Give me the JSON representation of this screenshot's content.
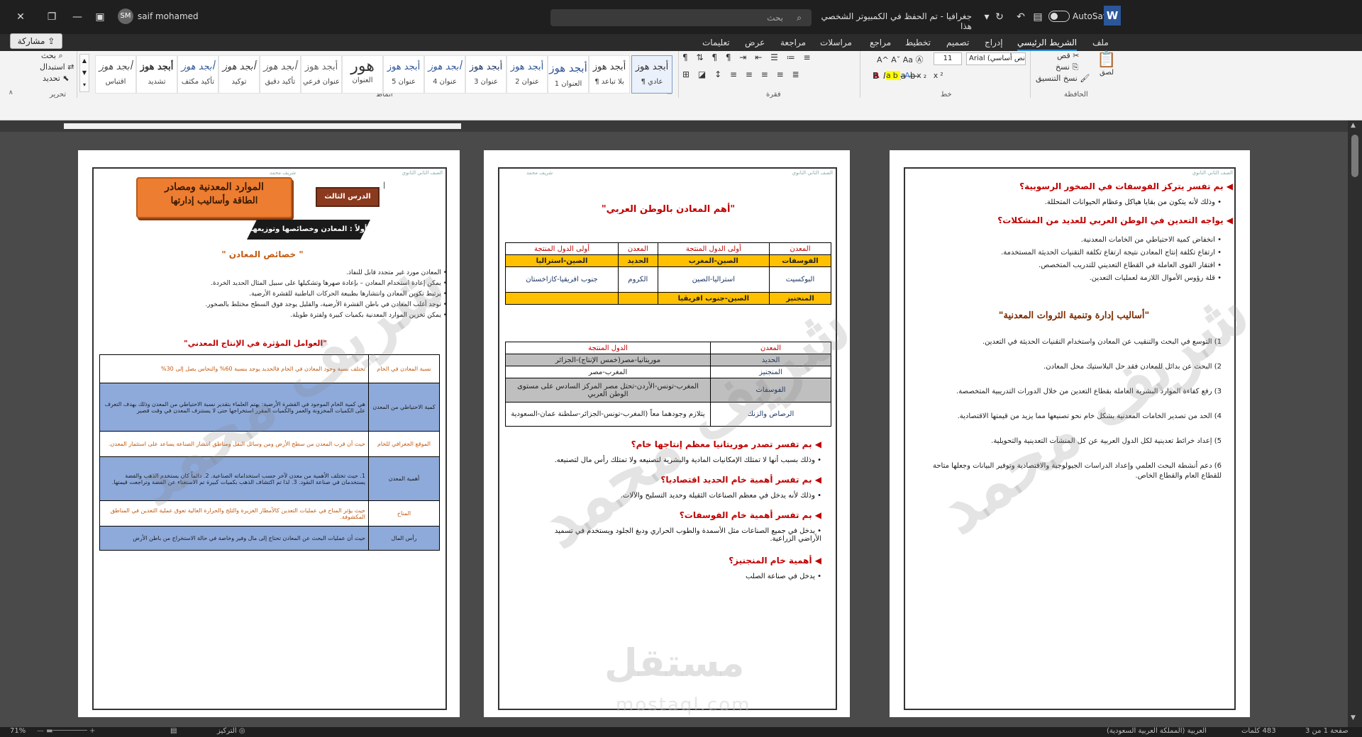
{
  "titlebar": {
    "doc_title": "جغرافيا - تم الحفظ في الكمبيوتر الشخصي هذا",
    "search_placeholder": "بحث",
    "autosave_label": "AutoSave",
    "user_name": "saif mohamed",
    "user_initials": "SM"
  },
  "tabs": [
    "ملف",
    "الشريط الرئيسي",
    "إدراج",
    "تصميم",
    "تخطيط",
    "مراجع",
    "مراسلات",
    "مراجعة",
    "عرض",
    "تعليمات"
  ],
  "share_label": "مشاركة",
  "ribbon": {
    "clipboard": {
      "group": "الحافظة",
      "paste": "لصق",
      "cut": "قص",
      "copy": "نسخ",
      "format_painter": "نسخ التنسيق"
    },
    "font": {
      "group": "خط",
      "font_name": "Arial (نص أساسي)",
      "font_size": "11"
    },
    "paragraph": {
      "group": "فقرة"
    },
    "styles": {
      "group": "أنماط",
      "items": [
        {
          "preview": "أبجد هوز",
          "name": "¶ عادي"
        },
        {
          "preview": "أبجد هوز",
          "name": "¶ بلا تباعد"
        },
        {
          "preview": "أبجد هوز",
          "name": "العنوان 1"
        },
        {
          "preview": "أبجد هوز",
          "name": "عنوان 2"
        },
        {
          "preview": "أبجد هوز",
          "name": "عنوان 3"
        },
        {
          "preview": "أبجد هوز",
          "name": "عنوان 4"
        },
        {
          "preview": "أبجد هوز",
          "name": "عنوان 5"
        },
        {
          "preview": "هور",
          "name": "العنوان"
        },
        {
          "preview": "أبجد هوز",
          "name": "عنوان فرعي"
        },
        {
          "preview": "أبجد هوز",
          "name": "تأكيد دقيق"
        },
        {
          "preview": "أبجد هوز",
          "name": "توكيد"
        },
        {
          "preview": "أبجد هوز",
          "name": "تأكيد مكثف"
        },
        {
          "preview": "أبجد هوز",
          "name": "تشديد"
        },
        {
          "preview": "أبجد هوز",
          "name": "اقتباس"
        }
      ]
    },
    "editing": {
      "group": "تحرير",
      "find": "بحث",
      "replace": "استبدال",
      "select": "تحديد"
    }
  },
  "page_header": {
    "right": "الصف الثاني الثانوي",
    "left": "شريف محمد"
  },
  "page1": {
    "title_line1": "الموارد المعدنية ومصادر",
    "title_line2": "الطاقة وأساليب إدارتها",
    "lesson": "الدرس الثالث",
    "section": "أولاً : المعادن وخصائصها وتوزيعها",
    "subtitle": "\" خصائص المعادن \"",
    "bullets": [
      "المعادن مورد غير متجدد قابل للنفاذ.",
      "يمكن إعادة استخدام المعادن – بإعادة صهرها وتشكيلها على سبيل المثال الحديد الخردة.",
      "يرتبط تكوين المعادن وانتشارها بطبيعة الحركات الباطنية للقشرة الأرضية.",
      "توجد أغلب المعادن في باطن القشرة الأرضية، والقليل يوجد فوق السطح مختلط بالصخور.",
      "يمكن تخزين الموارد المعدنية بكميات كبيرة ولفترة طويلة."
    ],
    "factors_title": "\"العوامل المؤثرة في الإنتاج المعدني\"",
    "factors": [
      {
        "k": "نسبة المعادن في الخام",
        "v": "تختلف نسبة وجود المعادن في الخام فالحديد يوجد بنسبة 60% والنحاس يصل إلى 30%"
      },
      {
        "k": "كمية الاحتياطي من المعدن",
        "v": "هي كمية الخام الموجود في القشرة الأرضية: يهتم العلماء بتقدير نسبة الاحتياطي من المعدن وذلك بهدف التعرف على الكميات المخزونة والعمر والكميات المقرر استخراجها حتى لا يستنزف المعدن في وقت قصير"
      },
      {
        "k": "الموقع الجغرافي للخام",
        "v": "حيث أن قرب المعدن من سطح الأرض ومن وسائل النقل ومناطق انتشار الصناعة يساعد على استثمار المعدن."
      },
      {
        "k": "أهمية المعدن",
        "v": "1. حيث تختلف الأهمية من معدن لآخر حسب استخداماته الصناعية. 2. دائماً كان يستخدم الذهب والفضة يستخدمان في صناعة النقود. 3. لذا تم اكتشاف الذهب بكميات كبيرة تم الاستغناء عن الفضة وتراجعت قيمتها."
      },
      {
        "k": "المناخ",
        "v": "حيث يؤثر المناخ في عمليات التعدين كالأمطار الغزيرة والثلج والحرارة العالية تعوق عملية التعدين في المناطق المكشوفة."
      },
      {
        "k": "رأس المال",
        "v": "حيث أن عمليات البحث عن المعادن تحتاج إلى مال وفير وخاصة في حالة الاستخراج من باطن الأرض"
      }
    ]
  },
  "page2": {
    "title": "\"أهم المعادن بالوطن العربي\"",
    "table1_head": [
      "المعدن",
      "أولى الدول المنتجة",
      "المعدن",
      "أولى الدول المنتجة"
    ],
    "table1_rows": [
      [
        "الفوسفات",
        "الصين-المغرب",
        "الحديد",
        "الصين-استراليا"
      ],
      [
        "البوكسيت",
        "استراليا-الصين",
        "الكروم",
        "جنوب افريقيا-كازاخستان"
      ],
      [
        "المنجنيز",
        "الصين-جنوب افريقيا",
        "",
        ""
      ]
    ],
    "table2_head": [
      "المعدن",
      "الدول المنتجة"
    ],
    "table2_rows": [
      [
        "الحديد",
        "موريتانيا-مصر(خمس الإنتاج)-الجزائر"
      ],
      [
        "المنجنيز",
        "المغرب-مصر"
      ],
      [
        "الفوسفات",
        "المغرب-تونس-الأردن-تحتل مصر المركز السادس على مستوى الوطن العربي"
      ],
      [
        "الرصاص والزنك",
        "يتلازم وجودهما معاً (المغرب-تونس-الجزائر-سلطنة عمان-السعودية"
      ]
    ],
    "qa": [
      {
        "q": "بم تفسر تصدر موريتانيا معظم إنتاجها خام؟",
        "a": [
          "وذلك بسبب أنها لا تمتلك الإمكانيات المادية والبشرية لتصنيعه ولا تمتلك رأس مال لتصنيعه."
        ]
      },
      {
        "q": "بم تفسر أهمية خام الحديد اقتصاديا؟",
        "a": [
          "وذلك لأنه يدخل في معظم الصناعات الثقيلة وحديد التسليح والآلات."
        ]
      },
      {
        "q": "بم تفسر أهمية خام الفوسفات؟",
        "a": [
          "يدخل في جميع الصناعات مثل الأسمدة والطوب الحراري ودبغ الجلود ويستخدم في تسميد الأراضي الزراعية."
        ]
      },
      {
        "q": "أهمية خام المنجنيز؟",
        "a": [
          "يدخل في صناعة الصلب"
        ]
      }
    ]
  },
  "page3": {
    "q1": "بم تفسر يتركز الفوسفات في الصخور الرسوبية؟",
    "a1": "وذلك لأنه يتكون من بقايا هياكل وعظام الحيوانات المتحللة.",
    "q2": "يواجه التعدين في الوطن العربي للعديد من المشكلات؟",
    "a2": [
      "انخفاض كمية الاحتياطي من الخامات المعدنية.",
      "ارتفاع تكلفة إنتاج المعادن نتيجة ارتفاع تكلفة التقنيات الحديثة المستخدمة.",
      "افتقار القوى العاملة في القطاع التعديني للتدريب المتخصص.",
      "قلة رؤوس الأموال اللازمة لعمليات التعدين."
    ],
    "section": "\"أساليب إدارة وتنمية الثروات المعدنية\"",
    "items": [
      "1) التوسع في البحث والتنقيب عن المعادن واستخدام التقنيات الحديثة في التعدين.",
      "2) البحث عن بدائل للمعادن فقد حل البلاستيك محل المعادن.",
      "3) رفع كفاءة الموارد البشرية العاملة بقطاع التعدين من خلال الدورات التدريبية المتخصصة.",
      "4) الحد من تصدير الخامات المعدنية بشكل خام نحو تصنيعها مما يزيد من قيمتها الاقتصادية.",
      "5) إعداد خرائط تعدينية لكل الدول العربية عن كل المنشآت التعدينية والتحويلية.",
      "6) دعم أنشطة البحث العلمي وإعداد الدراسات الجيولوجية والاقتصادية وتوفير البيانات وجعلها متاحة للقطاع العام والقطاع الخاص."
    ]
  },
  "watermark": "شريف محمد",
  "mostaql": {
    "ar": "مستقل",
    "en": "mostaql.com"
  },
  "status": {
    "zoom": "71%",
    "words": "483 كلمات",
    "page": "صفحة 1 من 3",
    "lang": "العربية (المملكة العربية السعودية)",
    "focus": "التركيز"
  }
}
